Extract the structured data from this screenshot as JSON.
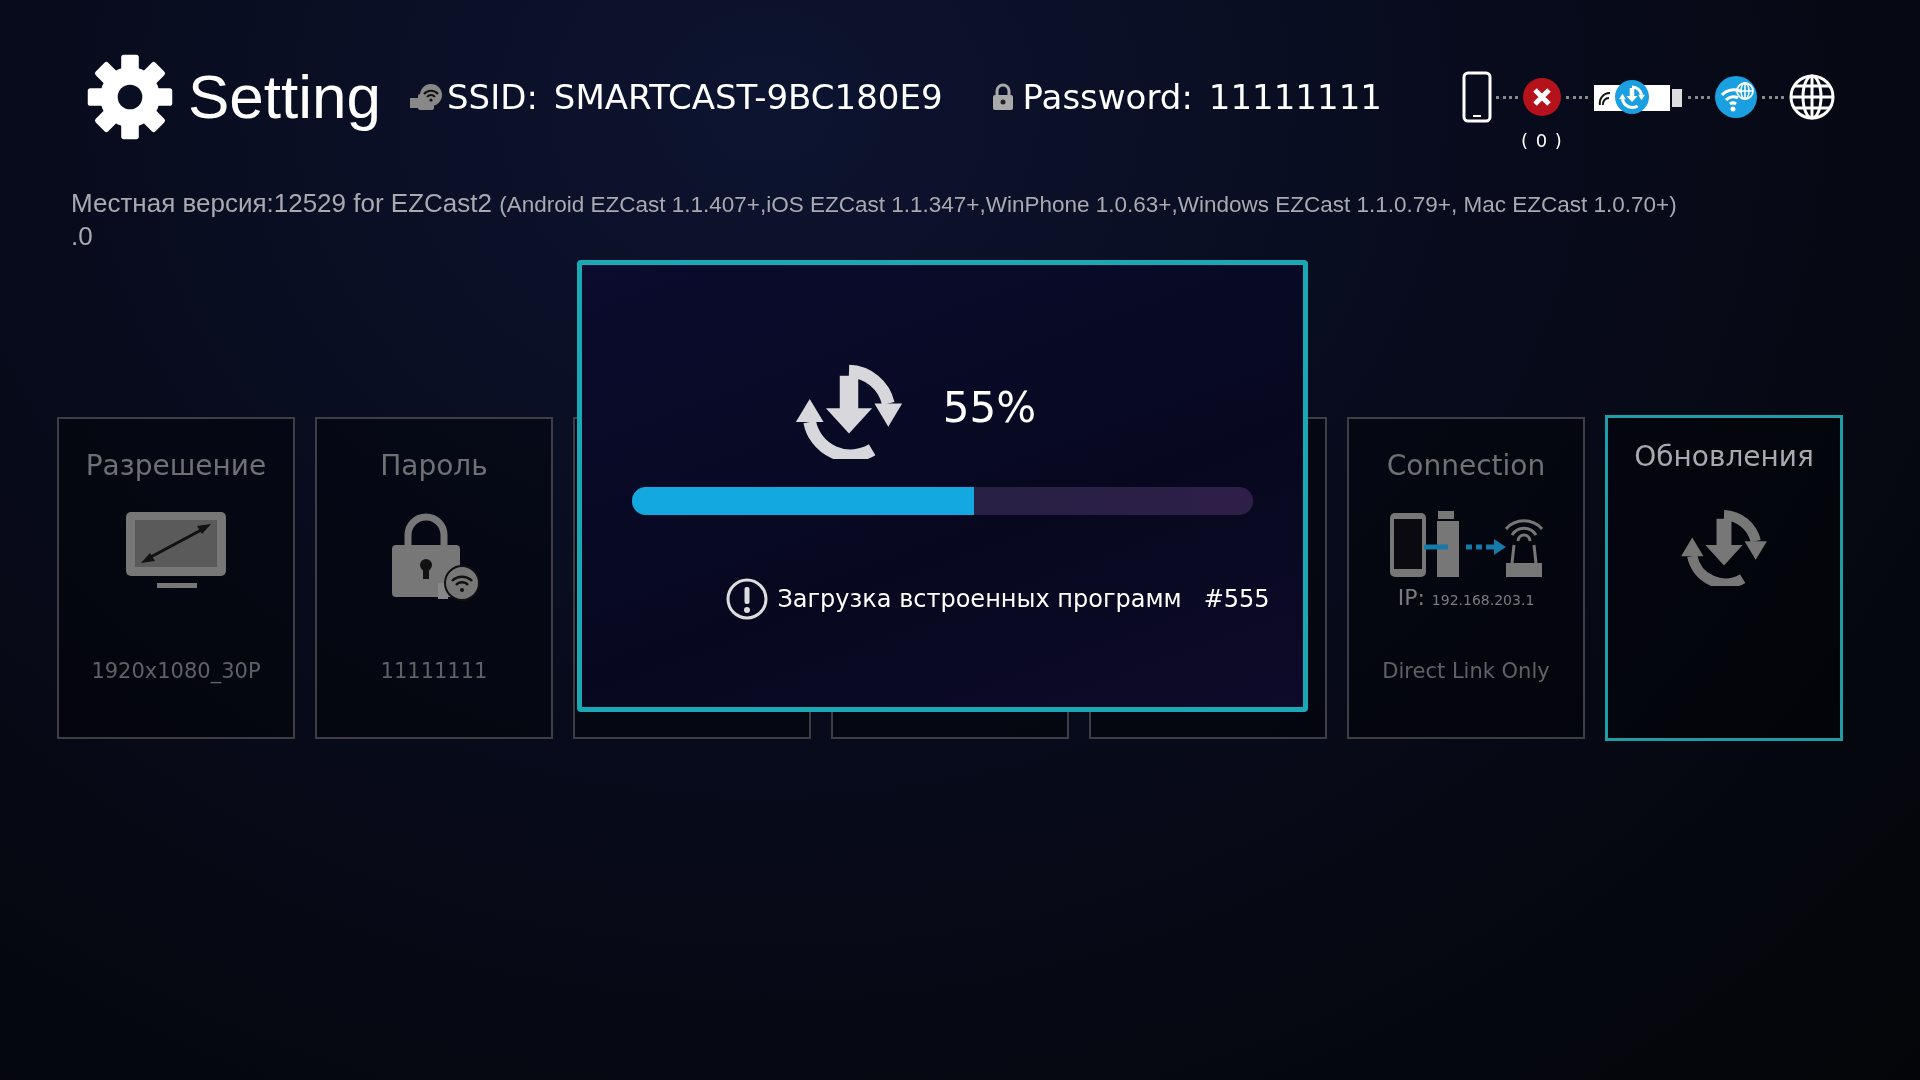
{
  "header": {
    "title": "Setting",
    "ssid_label": "SSID:",
    "ssid": "SMARTCAST-9BC180E9",
    "password_label": "Password:",
    "password": "11111111"
  },
  "status": {
    "phone_connected": false,
    "client_count": "( 0 )"
  },
  "version": {
    "text": "Местная версия:12529 for EZCast2",
    "compat": "(Android EZCast 1.1.407+,iOS EZCast 1.1.347+,WinPhone 1.0.63+,Windows EZCast 1.1.0.79+, Mac EZCast 1.0.70+)",
    "suffix": ".0"
  },
  "cards": [
    {
      "kind": "display",
      "title": "Разрешение",
      "value": "1920x1080_30P",
      "selected": false
    },
    {
      "kind": "lock",
      "title": "Пароль",
      "value": "11111111",
      "selected": false
    },
    {
      "kind": "hidden",
      "selected": false
    },
    {
      "kind": "hidden",
      "selected": false
    },
    {
      "kind": "hidden",
      "selected": false
    },
    {
      "kind": "connection",
      "title": "Connection",
      "ip_label": "IP:",
      "ip": "192.168.203.1",
      "value": "Direct Link Only",
      "selected": false
    },
    {
      "kind": "update",
      "title": "Обновления",
      "selected": true
    }
  ],
  "dialog": {
    "percent": "55%",
    "level": 0.55,
    "message": "Загрузка встроенных программ",
    "code": "#555"
  }
}
